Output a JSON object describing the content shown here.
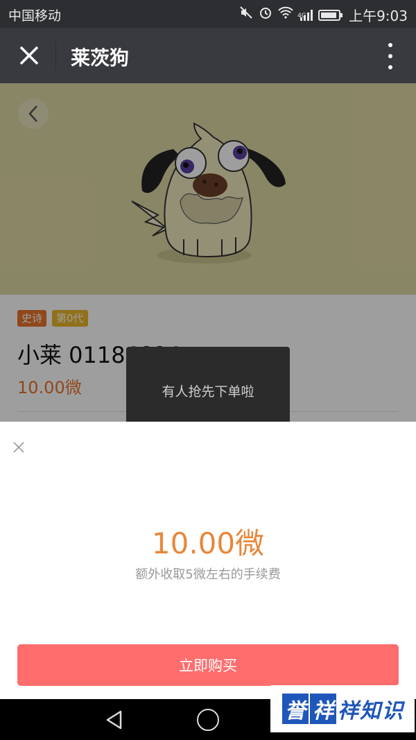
{
  "status_bar": {
    "carrier": "中国移动",
    "network_label": "4G",
    "time": "上午9:03"
  },
  "title_bar": {
    "title": "莱茨狗"
  },
  "listing": {
    "tags": [
      {
        "label": "史诗",
        "color": "#e8742a"
      },
      {
        "label": "第0代",
        "color": "#e8b52a"
      }
    ],
    "dog_name": "小莱 01186826",
    "price": "10.00微",
    "hero_bg_color": "#ded8a5"
  },
  "toast": {
    "message": "有人抢先下单啦"
  },
  "purchase_sheet": {
    "price": "10.00微",
    "fee_note": "额外收取5微左右的手续费",
    "buy_label": "立即购买",
    "accent_color": "#ff6d6d"
  },
  "watermark": {
    "chars": [
      "誉",
      "祥",
      "祥",
      "知",
      "识"
    ]
  }
}
